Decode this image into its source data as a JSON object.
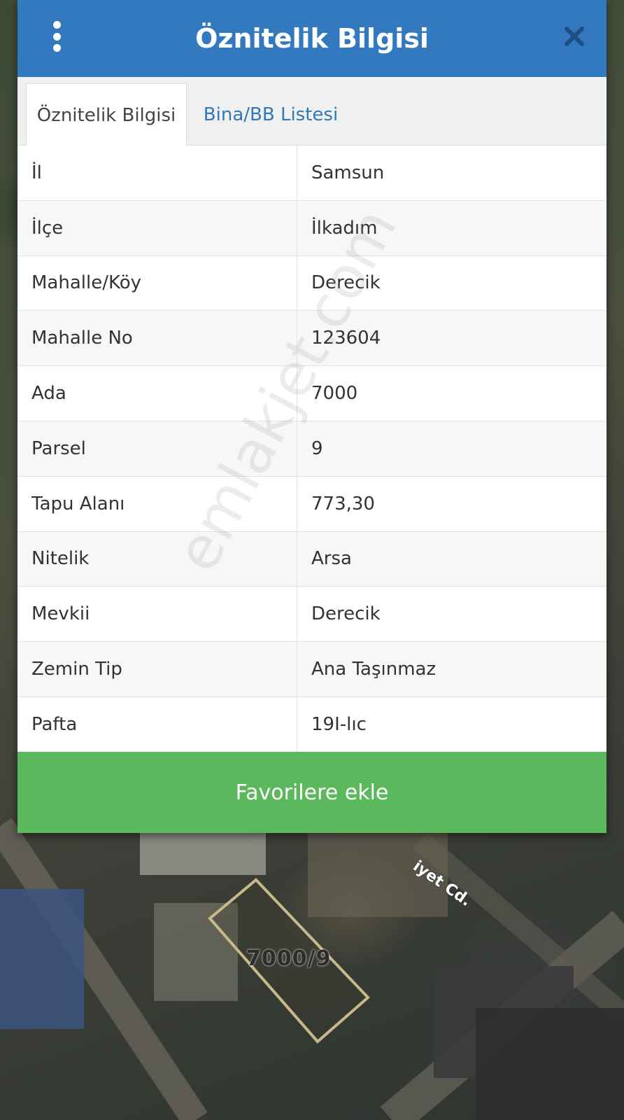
{
  "header": {
    "title": "Öznitelik Bilgisi",
    "menu_icon": "more-vertical-icon",
    "close_icon": "close-icon"
  },
  "tabs": [
    {
      "label": "Öznitelik Bilgisi",
      "active": true
    },
    {
      "label": "Bina/BB Listesi",
      "active": false
    }
  ],
  "attributes": [
    {
      "key": "İl",
      "value": "Samsun"
    },
    {
      "key": "İlçe",
      "value": "İlkadım"
    },
    {
      "key": "Mahalle/Köy",
      "value": "Derecik"
    },
    {
      "key": "Mahalle No",
      "value": "123604"
    },
    {
      "key": "Ada",
      "value": "7000"
    },
    {
      "key": "Parsel",
      "value": "9"
    },
    {
      "key": "Tapu Alanı",
      "value": "773,30"
    },
    {
      "key": "Nitelik",
      "value": "Arsa"
    },
    {
      "key": "Mevkii",
      "value": "Derecik"
    },
    {
      "key": "Zemin Tip",
      "value": "Ana Taşınmaz"
    },
    {
      "key": "Pafta",
      "value": "19I-lıc"
    }
  ],
  "favorite_button": {
    "label": "Favorilere ekle"
  },
  "watermark": "emlakjet.com",
  "map": {
    "parcel_label": "7000/9",
    "street_label": "iyet Cd."
  },
  "colors": {
    "header": "#3279bf",
    "button": "#5cb85c",
    "tab_link": "#2f79b8"
  }
}
